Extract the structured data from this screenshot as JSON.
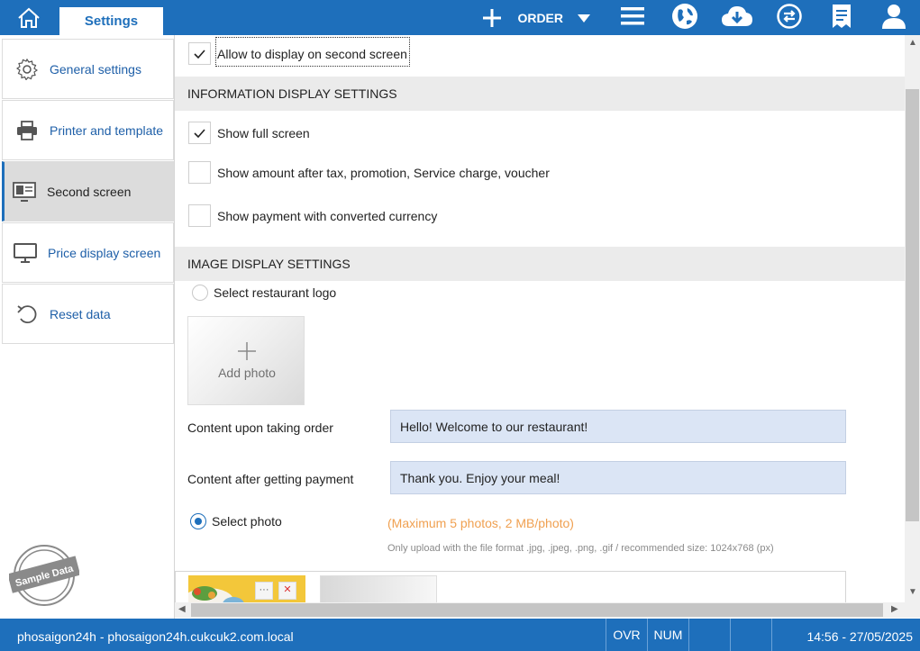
{
  "topbar": {
    "home_icon": "home-icon",
    "tab_label": "Settings",
    "order_label": "ORDER",
    "icons": [
      "plus-icon",
      "dropdown-arrow-icon",
      "menu-icon",
      "globe-icon",
      "cloud-download-icon",
      "sync-icon",
      "receipt-icon",
      "user-icon"
    ],
    "bar_color": "#1e6fbb"
  },
  "sidebar": {
    "items": [
      {
        "label": "General settings",
        "icon": "gear-icon"
      },
      {
        "label": "Printer and template",
        "icon": "printer-icon"
      },
      {
        "label": "Second screen",
        "icon": "second-screen-icon"
      },
      {
        "label": "Price display screen",
        "icon": "monitor-icon"
      },
      {
        "label": "Reset data",
        "icon": "reset-icon"
      }
    ],
    "active_index": 2,
    "watermark_text": "Sample Data"
  },
  "main": {
    "allow_display": {
      "label": "Allow to display on second screen",
      "checked": true
    },
    "info_section_title": "INFORMATION DISPLAY SETTINGS",
    "info_options": [
      {
        "label": "Show full screen",
        "checked": true
      },
      {
        "label": "Show amount after tax, promotion, Service charge, voucher",
        "checked": false
      },
      {
        "label": "Show payment with converted currency",
        "checked": false
      }
    ],
    "image_section_title": "IMAGE DISPLAY SETTINGS",
    "logo_option": {
      "label": "Select restaurant logo",
      "selected": false
    },
    "add_photo_label": "Add photo",
    "content_order": {
      "label": "Content upon taking order",
      "value": "Hello! Welcome to our restaurant!"
    },
    "content_payment": {
      "label": "Content after getting payment",
      "value": "Thank you. Enjoy your meal!"
    },
    "photo_option": {
      "label": "Select photo",
      "selected": true
    },
    "max_note": "(Maximum 5 photos, 2 MB/photo)",
    "format_note": "Only upload with the file format .jpg, .jpeg, .png, .gif / recommended size: 1024x768 (px)",
    "thumb_more": "···",
    "thumb_delete": "✕",
    "accent_orange": "#f0a050"
  },
  "statusbar": {
    "host": "phosaigon24h - phosaigon24h.cukcuk2.com.local",
    "ovr": "OVR",
    "num": "NUM",
    "time": "14:56 - 27/05/2025"
  }
}
